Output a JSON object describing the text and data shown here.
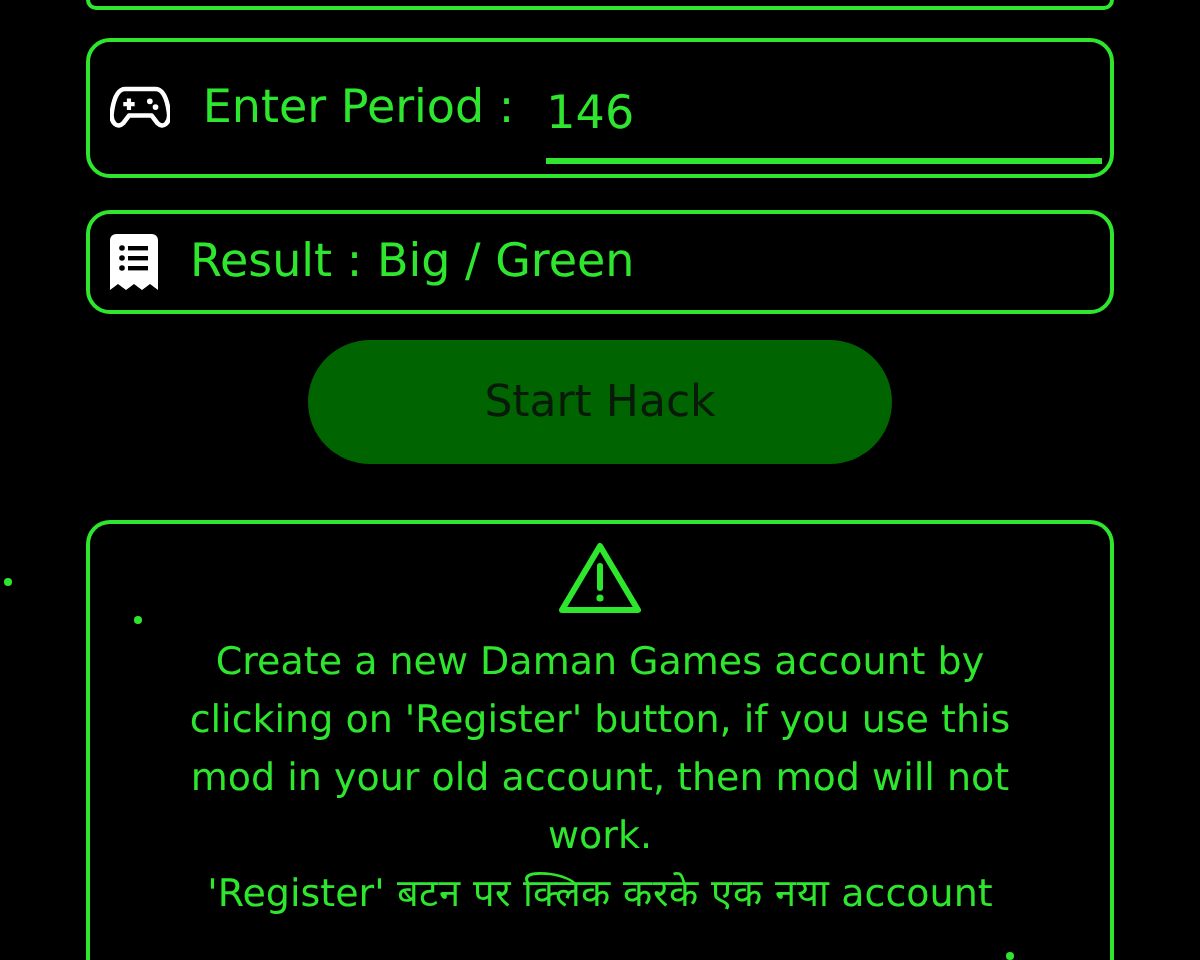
{
  "period": {
    "label": "Enter Period :",
    "value": "146"
  },
  "result": {
    "text": "Result : Big / Green"
  },
  "start_button": {
    "label": "Start Hack"
  },
  "notice": {
    "paragraphs": [
      "Create a new Daman Games account by clicking on 'Register' button, if you use this mod in your old account, then mod will not work.",
      "'Register' बटन पर क्लिक करके एक नया account"
    ]
  }
}
